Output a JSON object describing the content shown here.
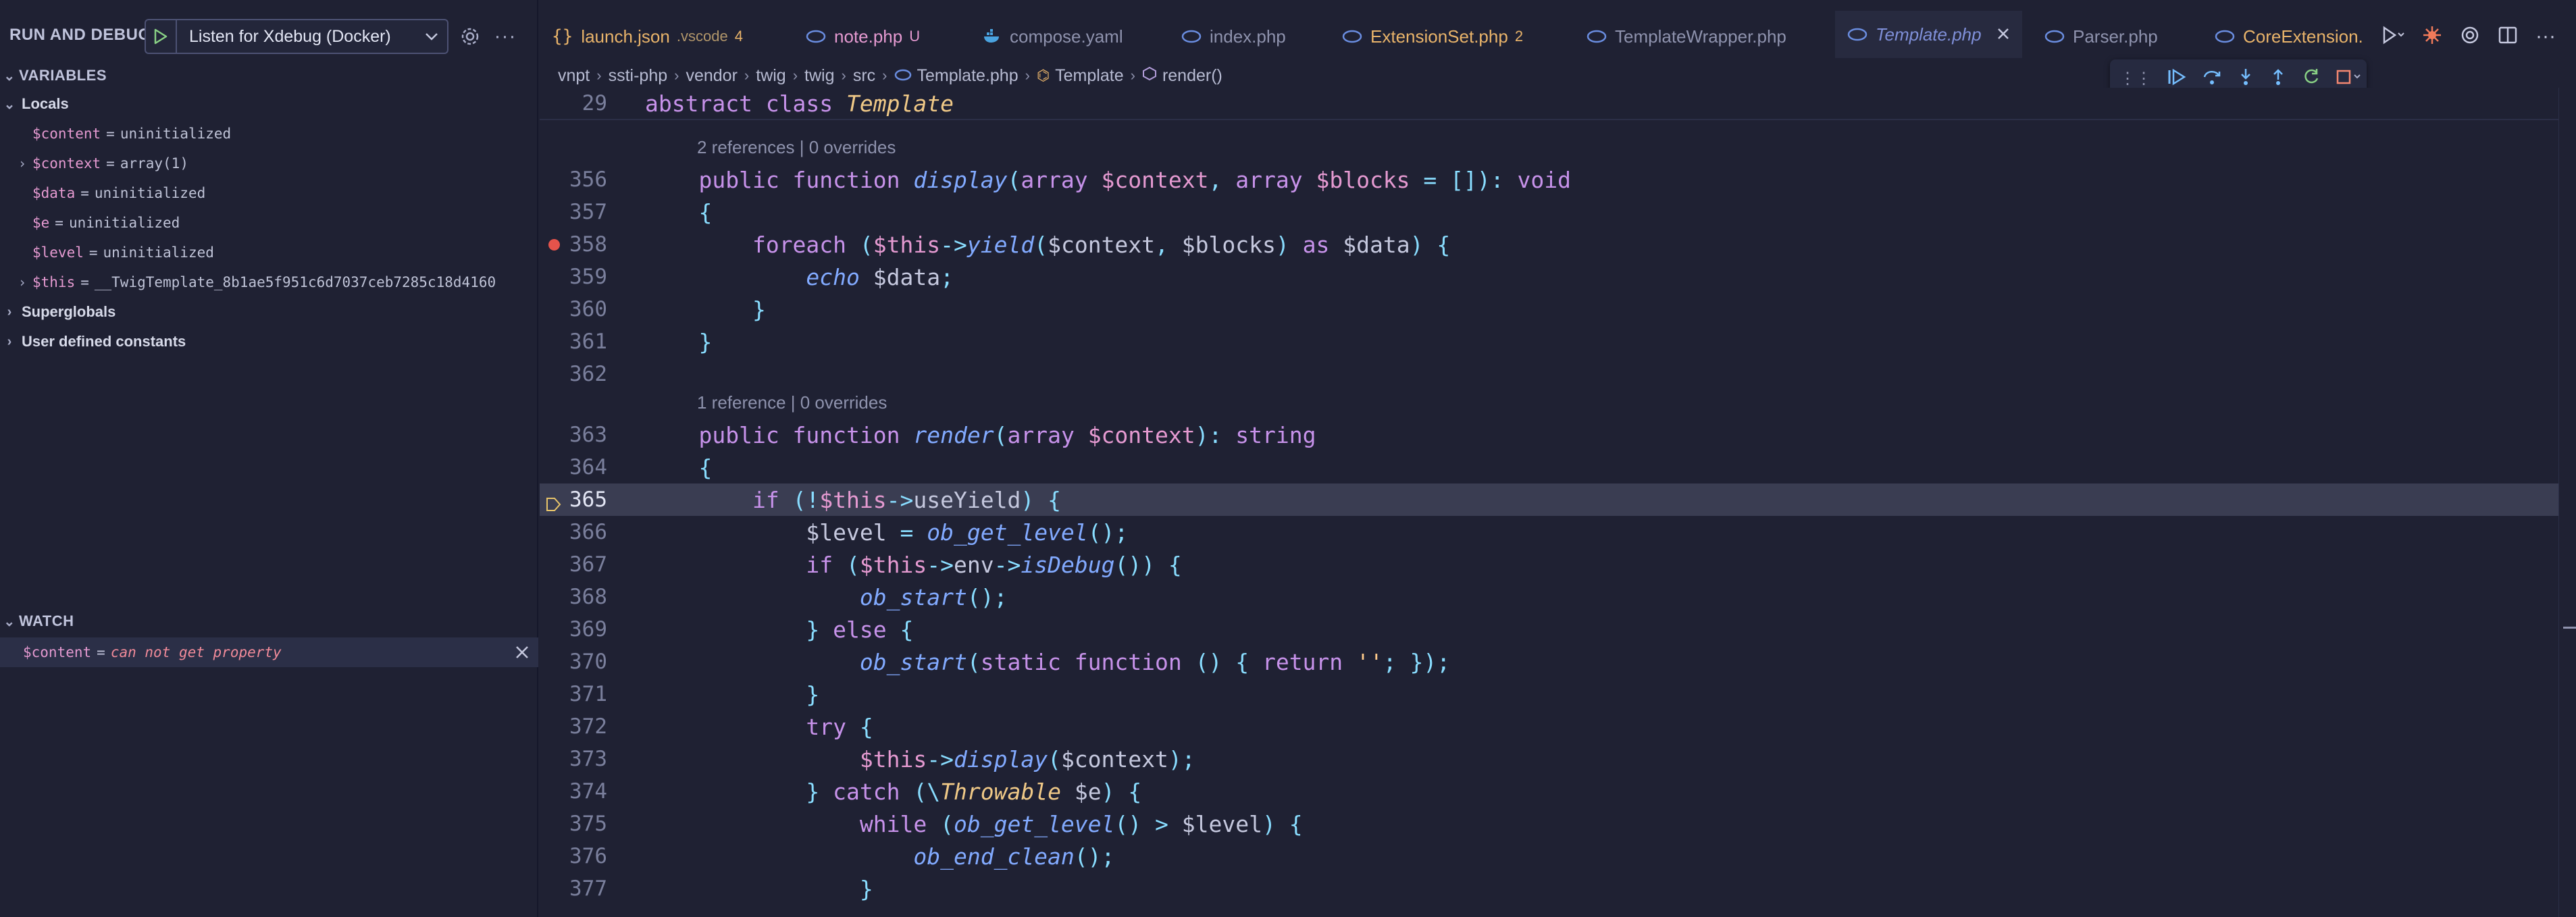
{
  "sidebar": {
    "title": "RUN AND DEBUG",
    "config": "Listen for Xdebug (Docker)",
    "variables_title": "VARIABLES",
    "locals_label": "Locals",
    "locals": [
      {
        "name": "$content",
        "value": "uninitialized"
      },
      {
        "name": "$context",
        "value": "array(1)"
      },
      {
        "name": "$data",
        "value": "uninitialized"
      },
      {
        "name": "$e",
        "value": "uninitialized"
      },
      {
        "name": "$level",
        "value": "uninitialized"
      },
      {
        "name": "$this",
        "value": "__TwigTemplate_8b1ae5f951c6d7037ceb7285c18d4160"
      }
    ],
    "superglobals_label": "Superglobals",
    "constants_label": "User defined constants",
    "watch_title": "WATCH",
    "watch": {
      "name": "$content",
      "value": "can not get property"
    }
  },
  "tabs": [
    {
      "label": "launch.json",
      "extra": ".vscode",
      "badge": "4",
      "icon": "json-braces-icon",
      "color": "#e8b36a"
    },
    {
      "label": "note.php",
      "badge": "U",
      "icon": "php-icon",
      "color": "#e59ad1"
    },
    {
      "label": "compose.yaml",
      "icon": "docker-icon",
      "color": "#8e92ad"
    },
    {
      "label": "index.php",
      "icon": "php-icon",
      "color": "#8e92ad"
    },
    {
      "label": "ExtensionSet.php",
      "badge": "2",
      "icon": "php-icon",
      "color": "#e8b36a"
    },
    {
      "label": "TemplateWrapper.php",
      "icon": "php-icon",
      "color": "#8e92ad"
    },
    {
      "label": "Template.php",
      "icon": "php-icon",
      "color": "#7f8fd8",
      "active": true
    },
    {
      "label": "Parser.php",
      "icon": "php-icon",
      "color": "#8e92ad"
    },
    {
      "label": "CoreExtension.",
      "icon": "php-icon",
      "color": "#e8b36a"
    }
  ],
  "breadcrumb": [
    "vnpt",
    "ssti-php",
    "vendor",
    "twig",
    "twig",
    "src",
    "Template.php",
    "Template",
    "render()"
  ],
  "editor": {
    "sticky": {
      "num": "29",
      "code": "abstract class Template"
    },
    "codelens_display": "2 references | 0 overrides",
    "codelens_render": "1 reference | 0 overrides",
    "current_line": "365",
    "breakpoint_line": "358"
  }
}
